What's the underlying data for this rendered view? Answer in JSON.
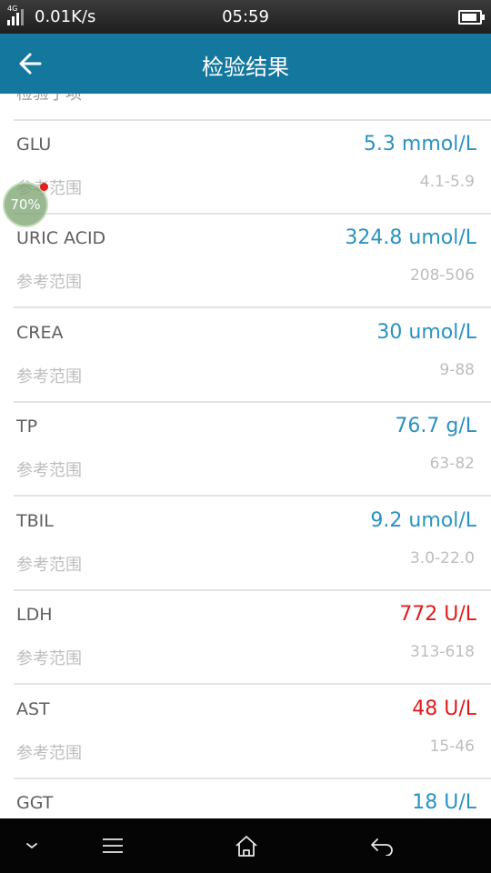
{
  "status_bar": {
    "network_tag": "4G",
    "speed": "0.01K/s",
    "time": "05:59"
  },
  "app_bar": {
    "title": "检验结果"
  },
  "partial_label": "检验子项",
  "floating_bubble": {
    "percent": "70%"
  },
  "results": [
    {
      "name": "GLU",
      "value": "5.3 mmol/L",
      "abnormal": false,
      "ref_label": "参考范围",
      "ref_range": "4.1-5.9"
    },
    {
      "name": "URIC ACID",
      "value": "324.8 umol/L",
      "abnormal": false,
      "ref_label": "参考范围",
      "ref_range": "208-506"
    },
    {
      "name": "CREA",
      "value": "30 umol/L",
      "abnormal": false,
      "ref_label": "参考范围",
      "ref_range": "9-88"
    },
    {
      "name": "TP",
      "value": "76.7 g/L",
      "abnormal": false,
      "ref_label": "参考范围",
      "ref_range": "63-82"
    },
    {
      "name": "TBIL",
      "value": "9.2 umol/L",
      "abnormal": false,
      "ref_label": "参考范围",
      "ref_range": "3.0-22.0"
    },
    {
      "name": "LDH",
      "value": "772 U/L",
      "abnormal": true,
      "ref_label": "参考范围",
      "ref_range": "313-618"
    },
    {
      "name": "AST",
      "value": "48 U/L",
      "abnormal": true,
      "ref_label": "参考范围",
      "ref_range": "15-46"
    },
    {
      "name": "GGT",
      "value": "18 U/L",
      "abnormal": false,
      "ref_label": "",
      "ref_range": ""
    }
  ],
  "colors": {
    "app_bar": "#14789e",
    "normal_value": "#2a92c2",
    "abnormal_value": "#e11b1b"
  },
  "nav_bar": {
    "icons": [
      "chevron-down-icon",
      "menu-icon",
      "home-icon",
      "back-icon"
    ]
  }
}
